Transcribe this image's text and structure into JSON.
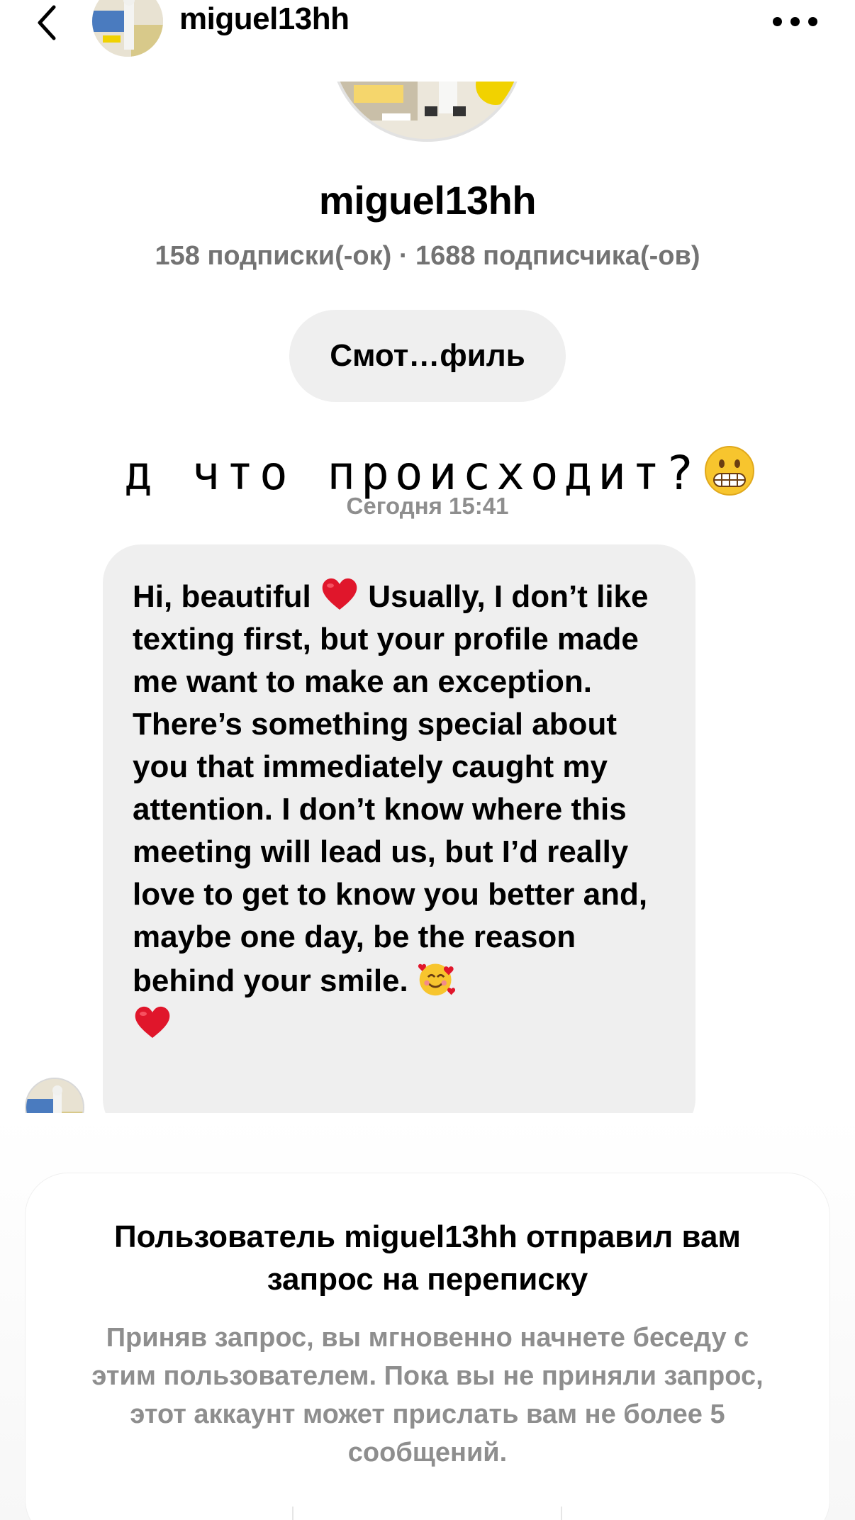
{
  "header": {
    "username": "miguel13hh",
    "back_icon": "chevron-left-icon",
    "more_icon": "more-horizontal-icon"
  },
  "profile": {
    "name": "miguel13hh",
    "stats": "158 подписки(-ок) · 1688 подписчика(-ов)",
    "view_profile_label": "Смот…филь"
  },
  "overlay_caption": {
    "text": "д что происходит?",
    "emoji": "grimacing-face-emoji"
  },
  "conversation": {
    "timestamp": "Сегодня 15:41",
    "messages": [
      {
        "sender": "miguel13hh",
        "part1": "Hi, beautiful ",
        "part2": " Usually, I don’t like texting first, but your profile made me want to make an exception. There’s something special about you that immediately caught my attention. I don’t know where this meeting will lead us, but I’d really love to get to know you better and, maybe one day, be the reason behind your smile. ",
        "emojis": [
          "red-heart-emoji",
          "smiling-face-with-hearts-emoji",
          "red-heart-emoji"
        ]
      }
    ]
  },
  "request": {
    "title": "Пользователь miguel13hh отправил вам запрос на переписку",
    "description": "Приняв запрос, вы мгновенно начнете беседу с этим пользователем. Пока вы не приняли запрос, этот аккаунт может прислать вам не более 5 сообщений."
  },
  "colors": {
    "bubble": "#efefef",
    "secondary_text": "#8e8e8e",
    "stats_text": "#737373",
    "heart": "#e0162b"
  }
}
